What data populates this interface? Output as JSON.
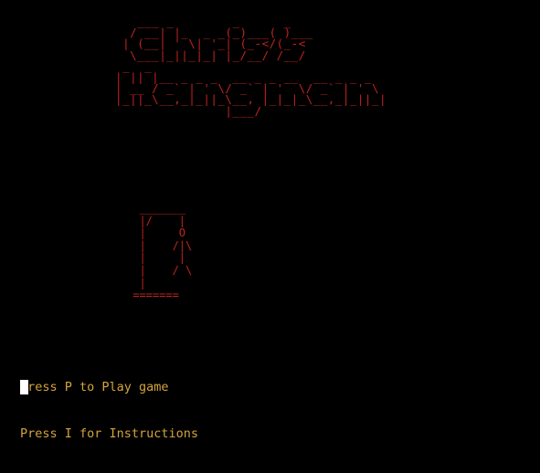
{
  "title_art": [
    "     ___ _        _      _      ",
    "    / __| |_  _ _(_)___( )___   ",
    "   | (__| ' \\| '_| (_-</(_-<   ",
    "    \\___|_||_|_| |_/__/ /__/    ",
    "   _  _                                       ",
    "  | || |__ _ _ _  __ _ _ __  __ _ _ _          ",
    "  | __ / _` | ' \\/ _` | '  \\/ _` | ' \\     ",
    "  |_||_\\__,_|_||_\\__, |_|_|_\\__,_|_||_|    ",
    "                 |___/                        "
  ],
  "gallows_art": [
    "  _______",
    "  |/    |",
    "  |     O",
    "  |    /|\\",
    "  |     |",
    "  |    / \\",
    "  |",
    " ======="
  ],
  "menu": {
    "play": "Press P to Play game",
    "instructions": "Press I for Instructions"
  },
  "colors": {
    "background": "#000000",
    "art": "#c0241c",
    "menu_text": "#d4a43a",
    "cursor": "#ffffff"
  }
}
